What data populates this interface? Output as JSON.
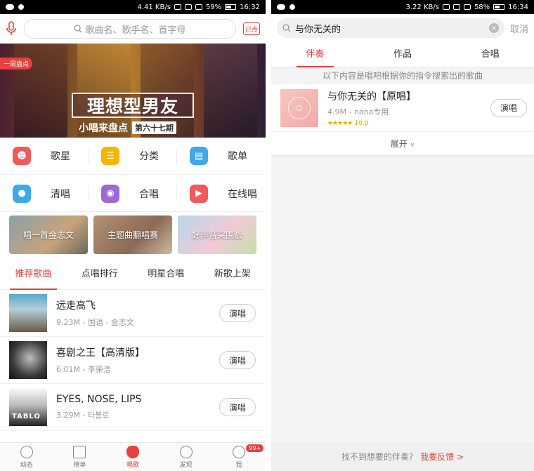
{
  "left": {
    "status": {
      "speed": "4.41 KB/s",
      "battery": "59%",
      "time": "16:32",
      "battery_level": 0.59
    },
    "search": {
      "placeholder": "歌曲名、歌手名、首字母",
      "ordered_label": "已点"
    },
    "banner": {
      "tag": "一周盘点",
      "title": "理想型男友",
      "subtitle": "小唱来盘点",
      "issue": "第六十七期"
    },
    "categories": [
      {
        "label": "歌星",
        "icon": "singer-icon",
        "color": "#f05a5a"
      },
      {
        "label": "分类",
        "icon": "list-icon",
        "color": "#f7b500"
      },
      {
        "label": "歌单",
        "icon": "playlist-icon",
        "color": "#3fa8e8"
      },
      {
        "label": "清唱",
        "icon": "mic-icon",
        "color": "#3fa8e8"
      },
      {
        "label": "合唱",
        "icon": "duet-icon",
        "color": "#9b6ad6"
      },
      {
        "label": "在线唱",
        "icon": "play-icon",
        "color": "#f05a5a"
      }
    ],
    "promos": [
      "唱一首金志文",
      "主题曲翻唱赛",
      "好声音突围战"
    ],
    "tabs": [
      "推荐歌曲",
      "点唱排行",
      "明星合唱",
      "新歌上架"
    ],
    "songs": [
      {
        "title": "远走高飞",
        "meta": "9.23M - 国语 - 金志文",
        "action": "演唱"
      },
      {
        "title": "喜剧之王【高清版】",
        "meta": "6.01M - 李荣浩",
        "action": "演唱"
      },
      {
        "title": "EYES, NOSE, LIPS",
        "meta": "3.29M - 타블로",
        "action": "演唱",
        "cover_text": "TABLO"
      }
    ],
    "nav": [
      {
        "label": "动态",
        "icon": "activity-icon"
      },
      {
        "label": "榜单",
        "icon": "chart-icon"
      },
      {
        "label": "唱歌",
        "icon": "sing-icon"
      },
      {
        "label": "发现",
        "icon": "compass-icon"
      },
      {
        "label": "我",
        "icon": "profile-icon",
        "badge": "99+"
      }
    ]
  },
  "right": {
    "status": {
      "speed": "3.22 KB/s",
      "battery": "58%",
      "time": "16:34",
      "battery_level": 0.58
    },
    "search": {
      "query": "与你无关的",
      "cancel": "取消"
    },
    "tabs": [
      "伴奏",
      "作品",
      "合唱"
    ],
    "notice": "以下内容是唱吧根据你的指令搜索出的歌曲",
    "result": {
      "title": "与你无关的【原唱】",
      "meta": "4.9M - nana专用",
      "stars": "★★★★★",
      "rating": "10.0",
      "action": "演唱"
    },
    "expand": "展开",
    "footer": {
      "question": "找不到想要的伴奏?",
      "feedback": "我要反馈 >"
    }
  }
}
